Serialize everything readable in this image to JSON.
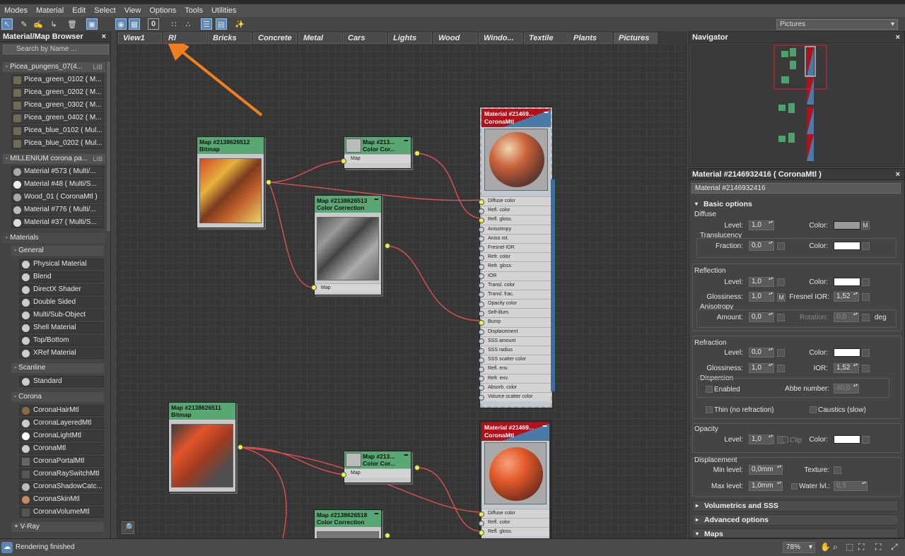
{
  "menu": [
    "Modes",
    "Material",
    "Edit",
    "Select",
    "View",
    "Options",
    "Tools",
    "Utilities"
  ],
  "view_select": {
    "value": "Pictures"
  },
  "browser": {
    "title": "Material/Map Browser",
    "search_placeholder": "Search by Name ...",
    "lib1": {
      "name": "- Picea_pungens_07(4...",
      "tag": "LIB",
      "items": [
        "Picea_green_0102  ( M...",
        "Picea_green_0202  ( M...",
        "Picea_green_0302  ( M...",
        "Picea_green_0402  ( M...",
        "Picea_blue_0102  ( Mul...",
        "Picea_blue_0202  ( Mul..."
      ]
    },
    "lib2": {
      "name": "- MILLENIUM corona pa...",
      "tag": "LIB",
      "items": [
        "Material #573  ( Multi/...",
        "Material #48  ( Multi/S...",
        "Wood_01  ( CoronaMtl )",
        "Material #776  ( Multi/...",
        "Material #37  ( Multi/S..."
      ]
    },
    "materials": {
      "header": "- Materials",
      "general_header": "- General",
      "general": [
        "Physical Material",
        "Blend",
        "DirectX Shader",
        "Double Sided",
        "Multi/Sub-Object",
        "Shell Material",
        "Top/Bottom",
        "XRef Material"
      ],
      "scanline_header": "- Scanline",
      "scanline": [
        "Standard"
      ],
      "corona_header": "- Corona",
      "corona": [
        "CoronaHairMtl",
        "CoronaLayeredMtl",
        "CoronaLightMtl",
        "CoronaMtl",
        "CoronaPortalMtl",
        "CoronaRaySwitchMtl",
        "CoronaShadowCatc...",
        "CoronaSkinMtl",
        "CoronaVolumeMtl"
      ],
      "vray_header": "+ V-Ray"
    }
  },
  "tabs": [
    "View1",
    "Rl",
    "Bricks",
    "Concrete",
    "Metal",
    "Cars",
    "Lights",
    "Wood",
    "Windo...",
    "Textile",
    "Plants",
    "Pictures"
  ],
  "nodes": {
    "bitmap1": {
      "title": "Map #2138626512",
      "sub": "Bitmap"
    },
    "cc_small1": {
      "title": "Map #213...",
      "sub": "Color Cor...",
      "slot": "Map"
    },
    "cc1": {
      "title": "Map #2138626513",
      "sub": "Color Correction",
      "slot": "Map"
    },
    "mat1": {
      "title": "Material #21469...",
      "sub": "CoronaMtl"
    },
    "mat_slots": [
      "Diffuse color",
      "Refl. color",
      "Refl. gloss.",
      "Anisotropy",
      "Aniso rot.",
      "Fresnel IOR",
      "Refr. color",
      "Refr. gloss.",
      "IOR",
      "Transl. color",
      "Transl. frac.",
      "Opacity color",
      "Self-illum.",
      "Bump",
      "Displacement",
      "SSS amount",
      "SSS radius",
      "SSS scatter color",
      "Refl. env.",
      "Refr. env.",
      "Absorb. color",
      "Volume scatter color"
    ],
    "bitmap2": {
      "title": "Map #2138626511",
      "sub": "Bitmap"
    },
    "cc_small2": {
      "title": "Map #213...",
      "sub": "Color Cor...",
      "slot": "Map"
    },
    "cc2": {
      "title": "Map #2138626518",
      "sub": "Color Correction"
    },
    "mat2": {
      "title": "Material #21469...",
      "sub": "CoronaMtl"
    },
    "mat2_slots": [
      "Diffuse color",
      "Refl. color",
      "Refl. gloss."
    ]
  },
  "navigator": {
    "title": "Navigator"
  },
  "props": {
    "title": "Material #2146932416  ( CoronaMtl )",
    "name_value": "Material #2146932416",
    "basic_options": "Basic options",
    "diffuse": {
      "header": "Diffuse",
      "level_label": "Level:",
      "level": "1,0",
      "color_label": "Color:",
      "m": "M",
      "translucency": "Translucency",
      "fraction_label": "Fraction:",
      "fraction": "0,0",
      "color2_label": "Color:"
    },
    "reflection": {
      "header": "Reflection",
      "level_label": "Level:",
      "level": "1,0",
      "color_label": "Color:",
      "gloss_label": "Glossiness:",
      "gloss": "1,0",
      "m": "M",
      "fresnel_label": "Fresnel IOR:",
      "fresnel": "1,52",
      "anisotropy": "Anisotropy",
      "amount_label": "Amount:",
      "amount": "0,0",
      "rotation_label": "Rotation:",
      "rotation": "0,0",
      "deg": "deg"
    },
    "refraction": {
      "header": "Refraction",
      "level_label": "Level:",
      "level": "0,0",
      "color_label": "Color:",
      "gloss_label": "Glossiness:",
      "gloss": "1,0",
      "ior_label": "IOR:",
      "ior": "1,52",
      "dispersion": "Dispersion",
      "enabled": "Enabled",
      "abbe_label": "Abbe number:",
      "abbe": "40,0",
      "thin": "Thin (no refraction)",
      "caustics": "Caustics (slow)"
    },
    "opacity": {
      "header": "Opacity",
      "level_label": "Level:",
      "level": "1,0",
      "clip": "Clip",
      "color_label": "Color:"
    },
    "displacement": {
      "header": "Displacement",
      "min_label": "Min level:",
      "min": "0,0mm",
      "texture_label": "Texture:",
      "max_label": "Max level:",
      "max": "1,0mm",
      "water_label": "Water lvl.:",
      "water": "0,5"
    },
    "rollouts": [
      "Volumetrics and SSS",
      "Advanced options",
      "Maps"
    ]
  },
  "status": {
    "text": "Rendering finished",
    "zoom": "78%"
  },
  "colors": {
    "node_header": "#59a772",
    "wire": "#e0504e",
    "socket": "#e8f63c",
    "selection_blue": "#5b87b4",
    "arrow": "#f07d1e"
  }
}
